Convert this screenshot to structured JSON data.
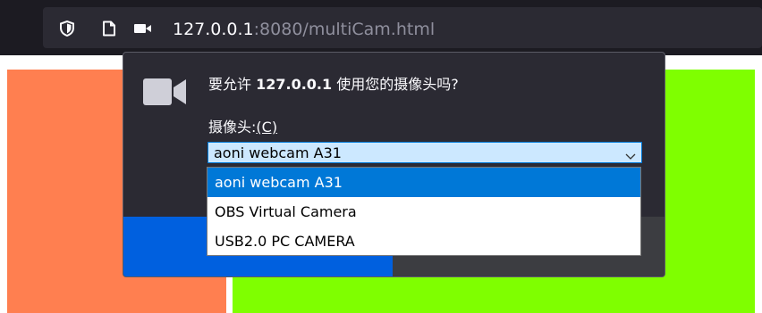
{
  "urlbar": {
    "url_host": "127.0.0.1",
    "url_rest": ":8080/multiCam.html",
    "icons": [
      "shield-icon",
      "page-icon",
      "camera-permission-icon"
    ]
  },
  "permission_panel": {
    "prompt_pre": "要允许 ",
    "prompt_host": "127.0.0.1",
    "prompt_post": " 使用您的摄像头吗?",
    "camera_label": "摄像头:",
    "camera_accesskey": "(C)",
    "selected_camera": "aoni webcam A31",
    "camera_options": [
      "aoni webcam A31",
      "OBS Virtual Camera",
      "USB2.0 PC CAMERA"
    ],
    "selected_index": 0
  },
  "colors": {
    "orange_block": "#ff7f50",
    "green_block": "#7fff00",
    "allow_button": "#0060df",
    "block_button": "#3c3d41",
    "selection": "#0078d7"
  }
}
